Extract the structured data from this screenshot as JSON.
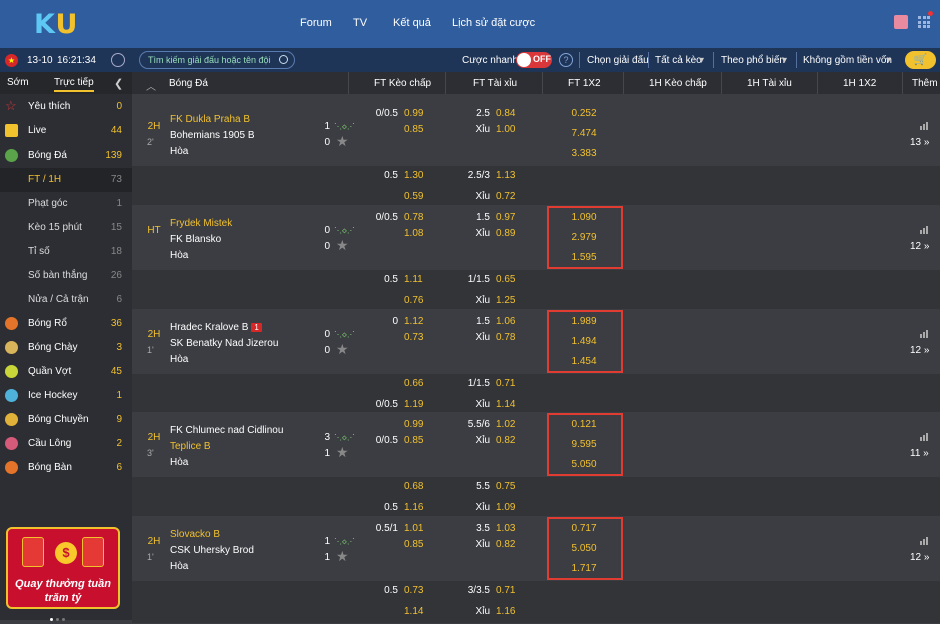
{
  "logo": {
    "k": "K",
    "u": "U"
  },
  "nav": [
    "Forum",
    "TV",
    "Kết quả",
    "Lịch sử đặt cược"
  ],
  "subbar": {
    "date": "13-10",
    "time": "16:21:34",
    "search_placeholder": "Tìm kiếm giải đấu hoặc tên đội",
    "quick_bet": "Cược nhanh",
    "toggle": "OFF",
    "help": "?",
    "league_select": "Chọn giải đấu",
    "filters": [
      "Tất cả kèo",
      "Theo phổ biến",
      "Không gồm tiền vốn"
    ]
  },
  "sidebar": {
    "tabs": [
      "Sớm",
      "Trực tiếp"
    ],
    "items": [
      {
        "label": "Yêu thích",
        "count": "0",
        "color": "#d9373a"
      },
      {
        "label": "Live",
        "count": "44",
        "color": "#f2c12e"
      },
      {
        "label": "Bóng Đá",
        "count": "139",
        "color": "#5aa34a"
      },
      {
        "label": "FT / 1H",
        "count": "73"
      },
      {
        "label": "Phạt góc",
        "count": "1"
      },
      {
        "label": "Kèo 15 phút",
        "count": "15"
      },
      {
        "label": "Tỉ số",
        "count": "18"
      },
      {
        "label": "Số bàn thắng",
        "count": "26"
      },
      {
        "label": "Nửa / Cả trận",
        "count": "6"
      },
      {
        "label": "Bóng Rổ",
        "count": "36",
        "color": "#e3742a"
      },
      {
        "label": "Bóng Chày",
        "count": "3",
        "color": "#d8b45a"
      },
      {
        "label": "Quần Vợt",
        "count": "45",
        "color": "#c9d63a"
      },
      {
        "label": "Ice Hockey",
        "count": "1",
        "color": "#4fb3d9"
      },
      {
        "label": "Bóng Chuyền",
        "count": "9",
        "color": "#e0b23a"
      },
      {
        "label": "Cầu Lông",
        "count": "2",
        "color": "#d65a7a"
      },
      {
        "label": "Bóng Bàn",
        "count": "6",
        "color": "#e3742a"
      }
    ],
    "promo": {
      "line1": "Quay thưởng tuần",
      "line2": "trăm tỷ",
      "coin": "$"
    }
  },
  "columns": [
    "Bóng Đá",
    "FT Kèo chấp",
    "FT Tài xỉu",
    "FT 1X2",
    "1H Kèo chấp",
    "1H Tài xỉu",
    "1H 1X2",
    "Thêm"
  ],
  "matches": [
    {
      "period": "2H",
      "minute": "2'",
      "home": "FK Dukla Praha B",
      "away": "Bohemians 1905 B",
      "draw": "Hòa",
      "hs": "1",
      "as": "0",
      "hc": [
        "0/0.5",
        ""
      ],
      "hco": [
        "0.99",
        "0.85"
      ],
      "ou": [
        "2.5",
        "Xỉu"
      ],
      "ouo": [
        "0.84",
        "1.00"
      ],
      "x12": [
        "0.252",
        "7.474",
        "3.383"
      ],
      "more": "13",
      "sub": [
        {
          "hc": "0.5",
          "hco": "1.30",
          "ou": "2.5/3",
          "ouo": "1.13"
        },
        {
          "hc": "",
          "hco": "0.59",
          "ou": "Xỉu",
          "ouo": "0.72"
        }
      ]
    },
    {
      "period": "HT",
      "minute": "",
      "home": "Frydek Mistek",
      "away": "FK Blansko",
      "draw": "Hòa",
      "hs": "0",
      "as": "0",
      "hc": [
        "0/0.5",
        ""
      ],
      "hco": [
        "0.78",
        "1.08"
      ],
      "ou": [
        "1.5",
        "Xỉu"
      ],
      "ouo": [
        "0.97",
        "0.89"
      ],
      "x12": [
        "1.090",
        "2.979",
        "1.595"
      ],
      "more": "12",
      "sub": [
        {
          "hc": "0.5",
          "hco": "1.11",
          "ou": "1/1.5",
          "ouo": "0.65"
        },
        {
          "hc": "",
          "hco": "0.76",
          "ou": "Xỉu",
          "ouo": "1.25"
        }
      ]
    },
    {
      "period": "2H",
      "minute": "1'",
      "home": "Hradec Kralove B",
      "away": "SK Benatky Nad Jizerou",
      "draw": "Hòa",
      "hs": "0",
      "as": "0",
      "redcard": "1",
      "hc": [
        "0",
        ""
      ],
      "hco": [
        "1.12",
        "0.73"
      ],
      "ou": [
        "1.5",
        "Xỉu"
      ],
      "ouo": [
        "1.06",
        "0.78"
      ],
      "x12": [
        "1.989",
        "1.494",
        "1.454"
      ],
      "more": "12",
      "sub": [
        {
          "hc": "",
          "hco": "0.66",
          "ou": "1/1.5",
          "ouo": "0.71"
        },
        {
          "hc": "0/0.5",
          "hco": "1.19",
          "ou": "Xỉu",
          "ouo": "1.14"
        }
      ]
    },
    {
      "period": "2H",
      "minute": "3'",
      "home": "FK Chlumec nad Cidlinou",
      "away": "Teplice B",
      "draw": "Hòa",
      "hs": "3",
      "as": "1",
      "hc": [
        "",
        "0/0.5"
      ],
      "hco": [
        "0.99",
        "0.85"
      ],
      "ou": [
        "5.5/6",
        "Xỉu"
      ],
      "ouo": [
        "1.02",
        "0.82"
      ],
      "x12": [
        "0.121",
        "9.595",
        "5.050"
      ],
      "more": "11",
      "sub": [
        {
          "hc": "",
          "hco": "0.68",
          "ou": "5.5",
          "ouo": "0.75"
        },
        {
          "hc": "0.5",
          "hco": "1.16",
          "ou": "Xỉu",
          "ouo": "1.09"
        }
      ]
    },
    {
      "period": "2H",
      "minute": "1'",
      "home": "Slovacko B",
      "away": "CSK Uhersky Brod",
      "draw": "Hòa",
      "hs": "1",
      "as": "1",
      "hc": [
        "0.5/1",
        ""
      ],
      "hco": [
        "1.01",
        "0.85"
      ],
      "ou": [
        "3.5",
        "Xỉu"
      ],
      "ouo": [
        "1.03",
        "0.82"
      ],
      "x12": [
        "0.717",
        "5.050",
        "1.717"
      ],
      "more": "12",
      "sub": [
        {
          "hc": "0.5",
          "hco": "0.73",
          "ou": "3/3.5",
          "ouo": "0.71"
        },
        {
          "hc": "",
          "hco": "1.14",
          "ou": "Xỉu",
          "ouo": "1.16"
        }
      ]
    }
  ]
}
